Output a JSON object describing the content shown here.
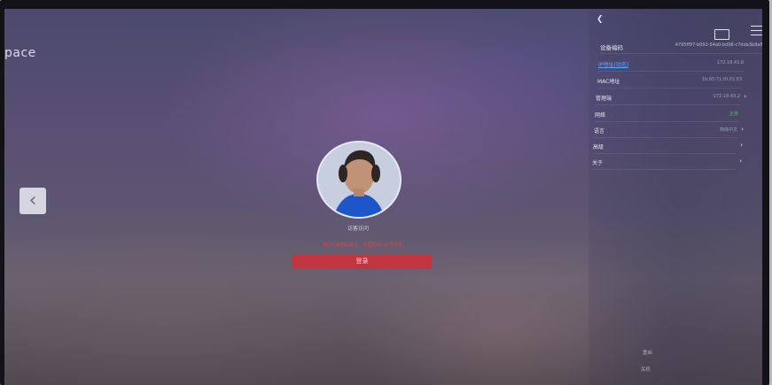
{
  "left": {
    "brand_fragment": "pace",
    "back_icon": "chevron-left-icon"
  },
  "login": {
    "username": "访客访问",
    "error": "用户名或密码错误，请重新输入账号信息",
    "button_label": "登录"
  },
  "panel": {
    "back_icon": "chevron-left-icon",
    "icons": [
      "screen-icon",
      "menu-icon"
    ],
    "rows": [
      {
        "label": "设备编码",
        "value": "4795ff97-b092-54a0-bd98-c7dda3b8a808"
      },
      {
        "label": "IP地址(动态)",
        "value": "172.18.43.8"
      },
      {
        "label": "MAC地址",
        "value": "1b:65:71:f0:01:63"
      },
      {
        "label": "管理端",
        "value": "172.18.43.2"
      },
      {
        "label": "网络",
        "value": "正常"
      },
      {
        "label": "语言",
        "value": "简体中文"
      },
      {
        "label": "高级",
        "value": ""
      },
      {
        "label": "关于",
        "value": ""
      }
    ],
    "footer": [
      "重启",
      "关机"
    ]
  },
  "colors": {
    "error": "#d64650",
    "login_button": "#c0353f",
    "link": "#5aa7ff",
    "ok": "#4cb96a"
  }
}
